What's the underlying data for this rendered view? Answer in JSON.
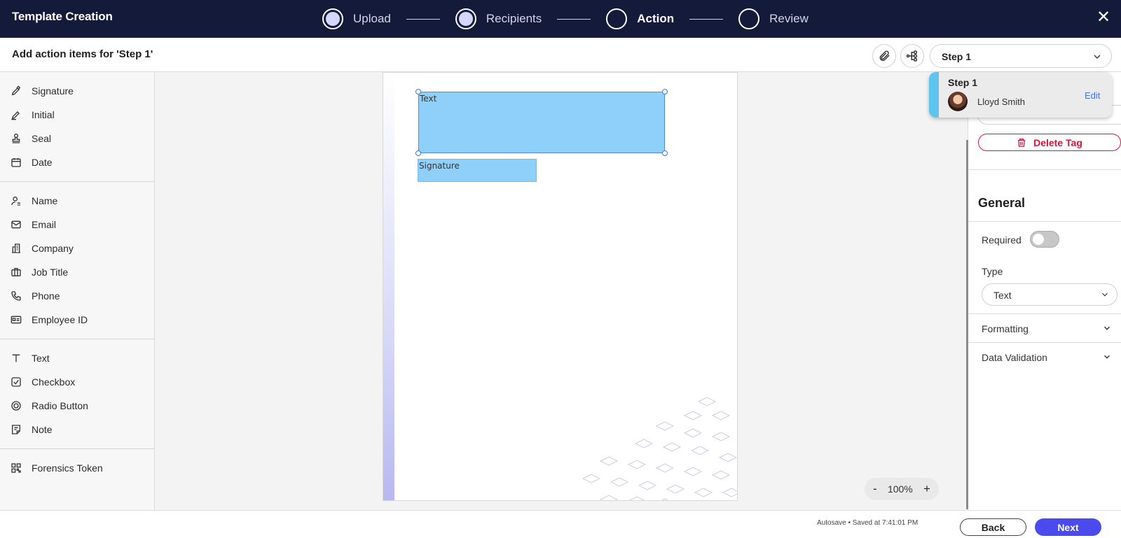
{
  "app": {
    "title": "Template Creation",
    "close_label": "✕"
  },
  "stepper": {
    "steps": [
      {
        "label": "Upload",
        "state": "completed"
      },
      {
        "label": "Recipients",
        "state": "completed"
      },
      {
        "label": "Action",
        "state": "current"
      },
      {
        "label": "Review",
        "state": "pending"
      }
    ]
  },
  "subheader": {
    "title": "Add action items for 'Step 1'",
    "attach_icon": "paperclip-icon",
    "workflow_icon": "workflow-icon",
    "step_select": "Step 1"
  },
  "tools": {
    "signing": [
      {
        "label": "Signature",
        "icon": "pen-nib-icon"
      },
      {
        "label": "Initial",
        "icon": "pen-initial-icon"
      },
      {
        "label": "Seal",
        "icon": "stamp-icon"
      },
      {
        "label": "Date",
        "icon": "calendar-icon"
      }
    ],
    "identity": [
      {
        "label": "Name",
        "icon": "person-icon"
      },
      {
        "label": "Email",
        "icon": "envelope-icon"
      },
      {
        "label": "Company",
        "icon": "building-icon"
      },
      {
        "label": "Job Title",
        "icon": "briefcase-icon"
      },
      {
        "label": "Phone",
        "icon": "phone-icon"
      },
      {
        "label": "Employee ID",
        "icon": "id-card-icon"
      }
    ],
    "inputs": [
      {
        "label": "Text",
        "icon": "text-t-icon"
      },
      {
        "label": "Checkbox",
        "icon": "checkbox-icon"
      },
      {
        "label": "Radio Button",
        "icon": "radio-icon"
      },
      {
        "label": "Note",
        "icon": "note-icon"
      }
    ],
    "security": [
      {
        "label": "Forensics Token",
        "icon": "qr-token-icon"
      }
    ]
  },
  "document": {
    "fields": [
      {
        "label": "Text",
        "selected": true
      },
      {
        "label": "Signature",
        "selected": false
      }
    ]
  },
  "zoom": {
    "minus": "-",
    "level": "100%",
    "plus": "+"
  },
  "step_popup": {
    "title": "Step 1",
    "name": "Lloyd Smith",
    "edit": "Edit"
  },
  "properties": {
    "delete_tag": "Delete Tag",
    "general_title": "General",
    "required_label": "Required",
    "required_on": false,
    "type_label": "Type",
    "type_value": "Text",
    "formatting": "Formatting",
    "data_validation": "Data Validation"
  },
  "footer": {
    "autosave": "Autosave • Saved at 7:41:01 PM",
    "back": "Back",
    "next": "Next"
  },
  "colors": {
    "topbar": "#141a3a",
    "field_fill": "#8fd0fb",
    "next_button": "#4a4aee",
    "delete_red": "#d0183a",
    "edit_link": "#3f72e6",
    "popup_accent": "#5ec4f0"
  }
}
